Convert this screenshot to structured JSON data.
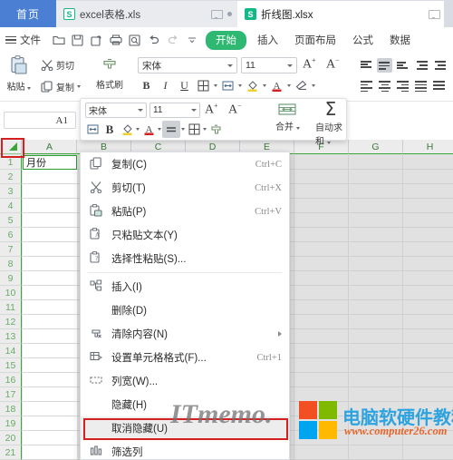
{
  "tabbar": {
    "home_label": "首页",
    "tabs": [
      {
        "title": "excel表格.xls",
        "icon": "spreadsheet-outline-icon",
        "active": false
      },
      {
        "title": "折线图.xlsx",
        "icon": "spreadsheet-solid-icon",
        "active": true
      }
    ]
  },
  "menubar": {
    "file_label": "文件",
    "quick_icons": [
      "open-folder-icon",
      "save-icon",
      "save-as-icon",
      "print-icon",
      "print-preview-icon",
      "undo-icon",
      "redo-icon",
      "customize-caret-icon"
    ],
    "ribbon_tabs": [
      {
        "label": "开始",
        "active": true
      },
      {
        "label": "插入",
        "active": false
      },
      {
        "label": "页面布局",
        "active": false
      },
      {
        "label": "公式",
        "active": false
      },
      {
        "label": "数据",
        "active": false
      }
    ]
  },
  "ribbon": {
    "paste_label": "粘贴",
    "cut_label": "剪切",
    "copy_label": "复制",
    "format_painter_label": "格式刷",
    "font_name": "宋体",
    "font_size": "11",
    "grow_font": "A",
    "grow_font_sup": "+",
    "shrink_font": "A",
    "shrink_font_sup": "−",
    "bold": "B",
    "italic": "I",
    "underline": "U"
  },
  "formula_bar": {
    "name_box_value": "A1"
  },
  "mini_toolbar": {
    "font_name": "宋体",
    "font_size": "11",
    "grow_font": "A",
    "shrink_font": "A",
    "bold": "B",
    "merge_label": "合并",
    "autosum_label": "自动求和",
    "autosum_glyph": "Σ"
  },
  "grid": {
    "columns": [
      "A",
      "B",
      "C",
      "D",
      "E",
      "F",
      "G",
      "H"
    ],
    "rows": [
      "1",
      "2",
      "3",
      "4",
      "5",
      "6",
      "7",
      "8",
      "9",
      "10",
      "11",
      "12",
      "13",
      "14",
      "15",
      "16",
      "17",
      "18",
      "19",
      "20",
      "21"
    ],
    "cells": {
      "A1": "月份"
    },
    "selected_cell": "A1"
  },
  "context_menu": {
    "items": [
      {
        "label": "复制(C)",
        "shortcut": "Ctrl+C",
        "icon": "copy-icon",
        "sep_after": false,
        "highlight": false,
        "submenu": false
      },
      {
        "label": "剪切(T)",
        "shortcut": "Ctrl+X",
        "icon": "cut-icon",
        "sep_after": false,
        "highlight": false,
        "submenu": false
      },
      {
        "label": "粘贴(P)",
        "shortcut": "Ctrl+V",
        "icon": "paste-icon",
        "sep_after": false,
        "highlight": false,
        "submenu": false
      },
      {
        "label": "只粘贴文本(Y)",
        "shortcut": "",
        "icon": "paste-text-icon",
        "sep_after": false,
        "highlight": false,
        "submenu": false
      },
      {
        "label": "选择性粘贴(S)...",
        "shortcut": "",
        "icon": "paste-special-icon",
        "sep_after": true,
        "highlight": false,
        "submenu": false
      },
      {
        "label": "插入(I)",
        "shortcut": "",
        "icon": "insert-icon",
        "sep_after": false,
        "highlight": false,
        "submenu": false
      },
      {
        "label": "删除(D)",
        "shortcut": "",
        "icon": "",
        "sep_after": false,
        "highlight": false,
        "submenu": false
      },
      {
        "label": "清除内容(N)",
        "shortcut": "",
        "icon": "clear-contents-icon",
        "sep_after": false,
        "highlight": false,
        "submenu": true
      },
      {
        "label": "设置单元格格式(F)...",
        "shortcut": "Ctrl+1",
        "icon": "format-cells-icon",
        "sep_after": false,
        "highlight": false,
        "submenu": false
      },
      {
        "label": "列宽(W)...",
        "shortcut": "",
        "icon": "column-width-icon",
        "sep_after": false,
        "highlight": false,
        "submenu": false
      },
      {
        "label": "隐藏(H)",
        "shortcut": "",
        "icon": "",
        "sep_after": false,
        "highlight": false,
        "submenu": false
      },
      {
        "label": "取消隐藏(U)",
        "shortcut": "",
        "icon": "",
        "sep_after": false,
        "highlight": true,
        "submenu": false
      },
      {
        "label": "筛选列",
        "shortcut": "",
        "icon": "filter-column-icon",
        "sep_after": false,
        "highlight": false,
        "submenu": false
      }
    ]
  },
  "watermark": {
    "itmemo": "ITmemo.",
    "site_name": "电脑软硬件教程网",
    "site_url": "www.computer26.com"
  },
  "colors": {
    "accent_green": "#2eb872",
    "home_blue": "#4a7fd4",
    "highlight_red": "#d42020",
    "grid_bg": "#e1e1e1",
    "wm_blue": "#2da3e0",
    "wm_orange": "#e8662a"
  }
}
